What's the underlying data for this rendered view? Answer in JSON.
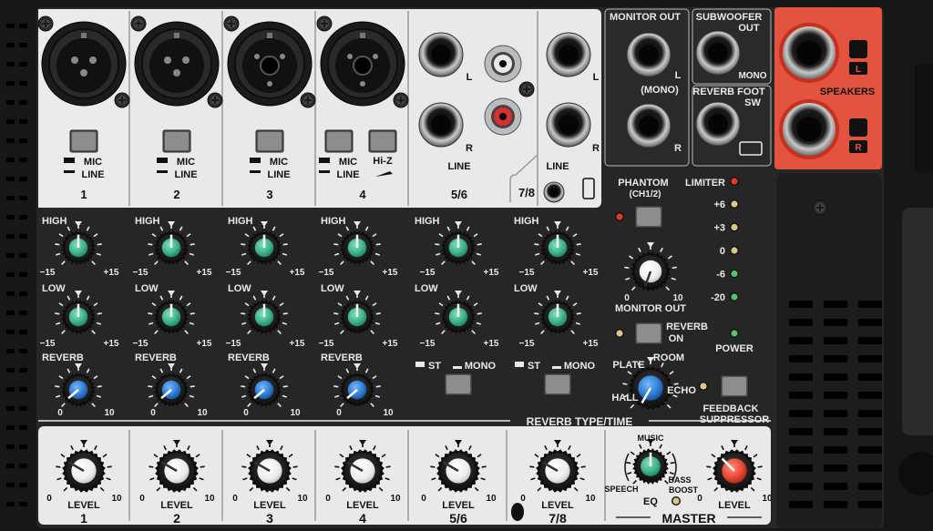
{
  "channels": [
    {
      "id": "1",
      "input": "xlr",
      "switch": [
        "MIC",
        "LINE"
      ]
    },
    {
      "id": "2",
      "input": "xlr",
      "switch": [
        "MIC",
        "LINE"
      ]
    },
    {
      "id": "3",
      "input": "combo",
      "switch": [
        "MIC",
        "LINE"
      ]
    },
    {
      "id": "4",
      "input": "combo",
      "switch": [
        "MIC",
        "LINE"
      ],
      "hiz": "Hi-Z"
    }
  ],
  "stereo": [
    {
      "id": "5/6",
      "jack_label": "LINE",
      "mode": [
        "ST",
        "MONO"
      ]
    },
    {
      "id": "7/8",
      "jack_label": "LINE",
      "mode": [
        "ST",
        "MONO"
      ]
    }
  ],
  "eq": {
    "high": "HIGH",
    "low": "LOW",
    "min": "−15",
    "max": "+15"
  },
  "reverb_send": {
    "label": "REVERB",
    "min": "0",
    "max": "10"
  },
  "level": {
    "label": "LEVEL",
    "min": "0",
    "max": "10"
  },
  "jack_labels": {
    "left": "L",
    "right": "R",
    "mono_note": "(MONO)"
  },
  "outputs": {
    "monitor_out": "MONITOR OUT",
    "subwoofer": [
      "SUBWOOFER",
      "OUT"
    ],
    "sub_mono": "MONO",
    "reverb_foot": [
      "REVERB FOOT",
      "SW"
    ],
    "speakers": "SPEAKERS"
  },
  "master_section": {
    "phantom": [
      "PHANTOM",
      "(CH1/2)"
    ],
    "limiter": "LIMITER",
    "meter_labels": [
      "+6",
      "+3",
      "0",
      "-6",
      "-20"
    ],
    "monitor_out_knob": "MONITOR OUT",
    "reverb_on": [
      "REVERB",
      "ON"
    ],
    "power": "POWER",
    "reverb_types": [
      "HALL",
      "PLATE",
      "ROOM",
      "ECHO"
    ],
    "reverb_type_time": "REVERB TYPE/TIME",
    "feedback": [
      "FEEDBACK",
      "SUPPRESSOR"
    ],
    "eq_music": "MUSIC",
    "eq_speech": "SPEECH",
    "eq_bass_boost": [
      "BASS",
      "BOOST"
    ],
    "eq_label": "EQ",
    "master_label": "MASTER"
  },
  "colors": {
    "panel": "#e9e9e9",
    "dark": "#2a2a2a",
    "eq_knob": "#3fb58a",
    "reverb_knob": "#2f7fd6",
    "master_knob": "#e84a35",
    "speaker_panel": "#e2543f"
  }
}
